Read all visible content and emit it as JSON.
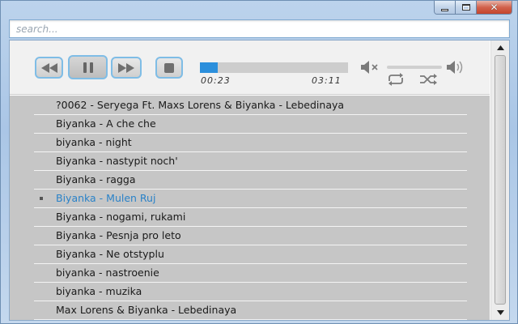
{
  "window": {
    "controls": {
      "minimize_icon": "minimize-icon",
      "maximize_icon": "maximize-icon",
      "close_icon": "close-icon",
      "close_glyph": "✕"
    }
  },
  "search": {
    "placeholder": "search...",
    "value": ""
  },
  "player": {
    "buttons": [
      "prev-icon",
      "pause-icon",
      "next-icon",
      "stop-icon"
    ],
    "time_elapsed": "00:23",
    "time_total": "03:11",
    "progress_fraction": 0.12,
    "volume_fraction": 0.0,
    "accent_color": "#2b8fdc",
    "button_border_color": "#7fbde6"
  },
  "playlist": {
    "active_index": 5,
    "active_color": "#2a82c8",
    "tracks": [
      "?0062 - Seryega Ft. Maxs Lorens & Biyanka - Lebedinaya",
      "Biyanka - A che che",
      "biyanka - night",
      "Biyanka - nastypit noch'",
      "Biyanka - ragga",
      "Biyanka - Mulen Ruj",
      "Biyanka - nogami, rukami",
      "Biyanka - Pesnja pro leto",
      "Biyanka - Ne otstyplu",
      "biyanka - nastroenie",
      "biyanka - muzika",
      "Max Lorens & Biyanka - Lebedinaya"
    ]
  }
}
